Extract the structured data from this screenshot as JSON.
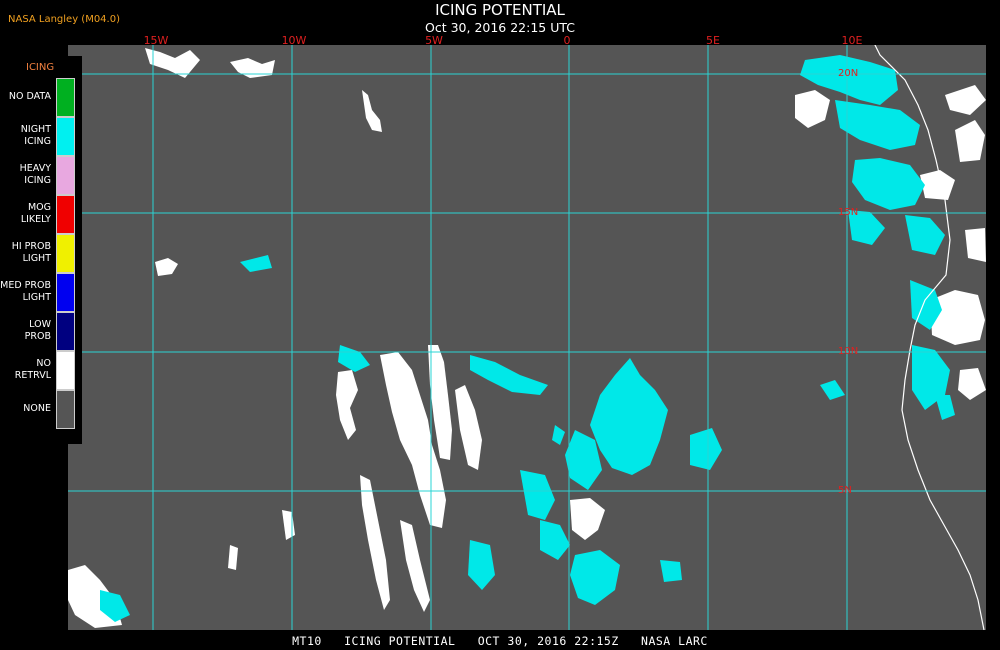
{
  "header": {
    "source_label": "NASA Langley (M04.0)",
    "title": "ICING POTENTIAL",
    "subtitle": "Oct 30, 2016 22:15 UTC"
  },
  "footer": {
    "text": "MT10   ICING POTENTIAL   OCT 30, 2016 22:15Z   NASA LARC"
  },
  "map": {
    "background_color": "#555555",
    "grid_color": "#2ad4d4",
    "longitude_labels": [
      "15W",
      "10W",
      "5W",
      "0",
      "5E",
      "10E"
    ],
    "latitude_labels": [
      "20N",
      "15N",
      "10N",
      "5N"
    ]
  },
  "legend": {
    "header": "ICING",
    "items": [
      {
        "label_line1": "NO DATA",
        "label_line2": "",
        "color": "#00b020"
      },
      {
        "label_line1": "NIGHT",
        "label_line2": "ICING",
        "color": "#00f0f0"
      },
      {
        "label_line1": "HEAVY",
        "label_line2": "ICING",
        "color": "#e8a8e0"
      },
      {
        "label_line1": "MOG",
        "label_line2": "LIKELY",
        "color": "#f00000"
      },
      {
        "label_line1": "HI PROB",
        "label_line2": "LIGHT",
        "color": "#f0f000"
      },
      {
        "label_line1": "MED PROB",
        "label_line2": "LIGHT",
        "color": "#0000f0"
      },
      {
        "label_line1": "LOW",
        "label_line2": "PROB",
        "color": "#000080"
      },
      {
        "label_line1": "NO",
        "label_line2": "RETRVL",
        "color": "#ffffff"
      },
      {
        "label_line1": "NONE",
        "label_line2": "",
        "color": "#555555"
      }
    ]
  }
}
